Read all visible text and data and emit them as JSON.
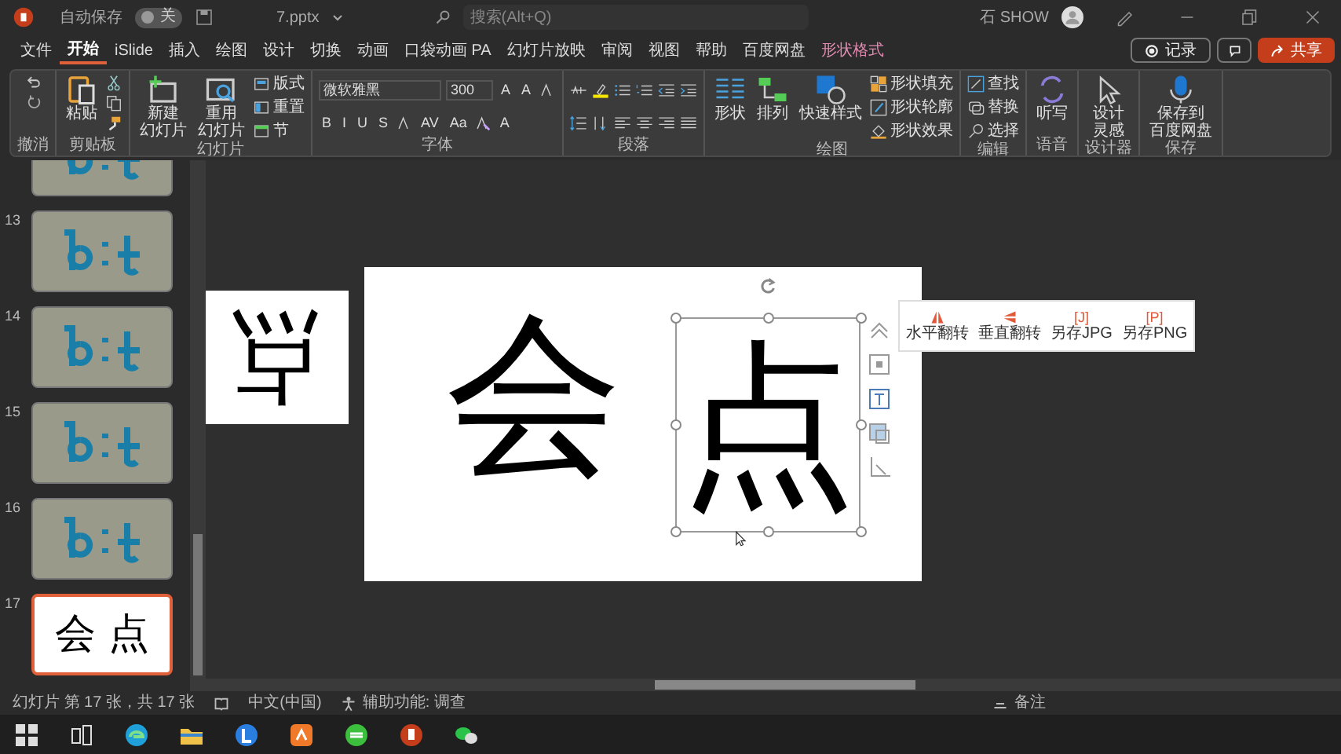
{
  "title_bar": {
    "autosave_label": "自动保存",
    "autosave_on": false,
    "autosave_state": "关",
    "filename": "7.pptx",
    "search": {
      "placeholder": "搜索(Alt+Q)"
    },
    "user": "石 SHOW"
  },
  "tabs": [
    {
      "label": "文件",
      "selected": false
    },
    {
      "label": "开始",
      "selected": true
    },
    {
      "label": "iSlide",
      "selected": false
    },
    {
      "label": "插入",
      "selected": false
    },
    {
      "label": "绘图",
      "selected": false
    },
    {
      "label": "设计",
      "selected": false
    },
    {
      "label": "切换",
      "selected": false
    },
    {
      "label": "动画",
      "selected": false
    },
    {
      "label": "口袋动画 PA",
      "selected": false
    },
    {
      "label": "幻灯片放映",
      "selected": false
    },
    {
      "label": "审阅",
      "selected": false
    },
    {
      "label": "视图",
      "selected": false
    },
    {
      "label": "帮助",
      "selected": false
    },
    {
      "label": "百度网盘",
      "selected": false
    },
    {
      "label": "形状格式",
      "selected": false,
      "kind": "contextual"
    }
  ],
  "header_buttons": {
    "record": "记录",
    "share": "共享"
  },
  "ribbon": {
    "groups": [
      {
        "label": "撤消",
        "kind": "columns",
        "columns": [
          [
            {
              "kind": "icon"
            },
            {
              "kind": "icon"
            }
          ]
        ]
      },
      {
        "label": "剪贴板",
        "kind": "columns",
        "columns": [
          [
            {
              "kind": "large",
              "label": "粘贴"
            }
          ],
          [
            {
              "kind": "icon"
            },
            {
              "kind": "icon"
            },
            {
              "kind": "icon"
            }
          ]
        ]
      },
      {
        "label": "幻灯片",
        "kind": "columns",
        "columns": [
          [
            {
              "kind": "large",
              "lines": [
                "新建",
                "幻灯片"
              ]
            }
          ],
          [
            {
              "kind": "large",
              "lines": [
                "重用",
                "幻灯片"
              ]
            }
          ],
          [
            {
              "kind": "small",
              "label": "版式"
            },
            {
              "kind": "small",
              "label": "重置"
            },
            {
              "kind": "small",
              "label": "节"
            }
          ]
        ]
      },
      {
        "label": "字体",
        "kind": "rows",
        "top": [
          {
            "kind": "font-field",
            "value": "微软雅黑"
          },
          {
            "kind": "size-field",
            "value": "300"
          },
          {
            "kind": "glyph",
            "label": "A"
          },
          {
            "kind": "glyph",
            "label": "A"
          },
          {
            "kind": "icon"
          }
        ],
        "bottom": [
          {
            "kind": "glyph",
            "label": "B"
          },
          {
            "kind": "glyph",
            "label": "I"
          },
          {
            "kind": "glyph",
            "label": "U"
          },
          {
            "kind": "glyph",
            "label": "S"
          },
          {
            "kind": "icon"
          },
          {
            "kind": "glyph",
            "label": "AV"
          },
          {
            "kind": "glyph",
            "label": "Aa"
          },
          {
            "kind": "icon"
          },
          {
            "kind": "glyph",
            "label": "A"
          }
        ]
      },
      {
        "label": "段落",
        "kind": "rows",
        "top": [
          {
            "kind": "icon"
          },
          {
            "kind": "icon"
          },
          {
            "kind": "icon"
          },
          {
            "kind": "icon"
          },
          {
            "kind": "icon"
          },
          {
            "kind": "icon"
          }
        ],
        "bottom": [
          {
            "kind": "icon"
          },
          {
            "kind": "icon"
          },
          {
            "kind": "icon"
          },
          {
            "kind": "icon"
          },
          {
            "kind": "icon"
          },
          {
            "kind": "icon"
          }
        ]
      },
      {
        "label": "绘图",
        "kind": "columns",
        "columns": [
          [
            {
              "kind": "large",
              "label": "形状"
            }
          ],
          [
            {
              "kind": "large",
              "label": "排列"
            }
          ],
          [
            {
              "kind": "large",
              "label": "快速样式"
            }
          ],
          [
            {
              "kind": "small",
              "label": "形状填充"
            },
            {
              "kind": "small",
              "label": "形状轮廓"
            },
            {
              "kind": "small",
              "label": "形状效果"
            }
          ]
        ]
      },
      {
        "label": "编辑",
        "kind": "columns",
        "columns": [
          [
            {
              "kind": "small",
              "label": "查找"
            },
            {
              "kind": "small",
              "label": "替换"
            },
            {
              "kind": "small",
              "label": "选择"
            }
          ]
        ]
      },
      {
        "label": "语音",
        "kind": "columns",
        "columns": [
          [
            {
              "kind": "large",
              "label": "听写"
            }
          ]
        ]
      },
      {
        "label": "设计器",
        "kind": "columns",
        "columns": [
          [
            {
              "kind": "large",
              "lines": [
                "设计",
                "灵感"
              ]
            }
          ]
        ]
      },
      {
        "label": "保存",
        "kind": "columns",
        "columns": [
          [
            {
              "kind": "large",
              "lines": [
                "保存到",
                "百度网盘"
              ]
            }
          ]
        ]
      }
    ]
  },
  "thumbnails": [
    {
      "kind": "logo",
      "selected": false
    },
    {
      "number": "13",
      "kind": "logo",
      "selected": false
    },
    {
      "number": "14",
      "kind": "logo",
      "selected": false
    },
    {
      "number": "15",
      "kind": "logo",
      "selected": false
    },
    {
      "number": "16",
      "kind": "logo",
      "selected": false
    },
    {
      "number": "17",
      "kind": "text",
      "text": "会 点",
      "selected": true
    }
  ],
  "canvas": {
    "previous_slide_text": "点",
    "slide": {
      "left_text": "会",
      "selected_text": "点"
    },
    "side_tools": [
      {
        "kind": "collapse"
      },
      {
        "kind": "frame"
      },
      {
        "kind": "text"
      },
      {
        "kind": "picture"
      },
      {
        "kind": "crop"
      }
    ],
    "popup": [
      {
        "label": "水平翻转",
        "kind": "flip-h"
      },
      {
        "label": "垂直翻转",
        "kind": "flip-v"
      },
      {
        "label": "另存JPG",
        "kind": "letter",
        "letter": "[J]"
      },
      {
        "label": "另存PNG",
        "kind": "letter",
        "letter": "[P]"
      }
    ]
  },
  "status_bar": {
    "slide_info": "幻灯片 第 17 张，共 17 张",
    "language": "中文(中国)",
    "accessibility": "辅助功能: 调查",
    "notes": "备注"
  }
}
